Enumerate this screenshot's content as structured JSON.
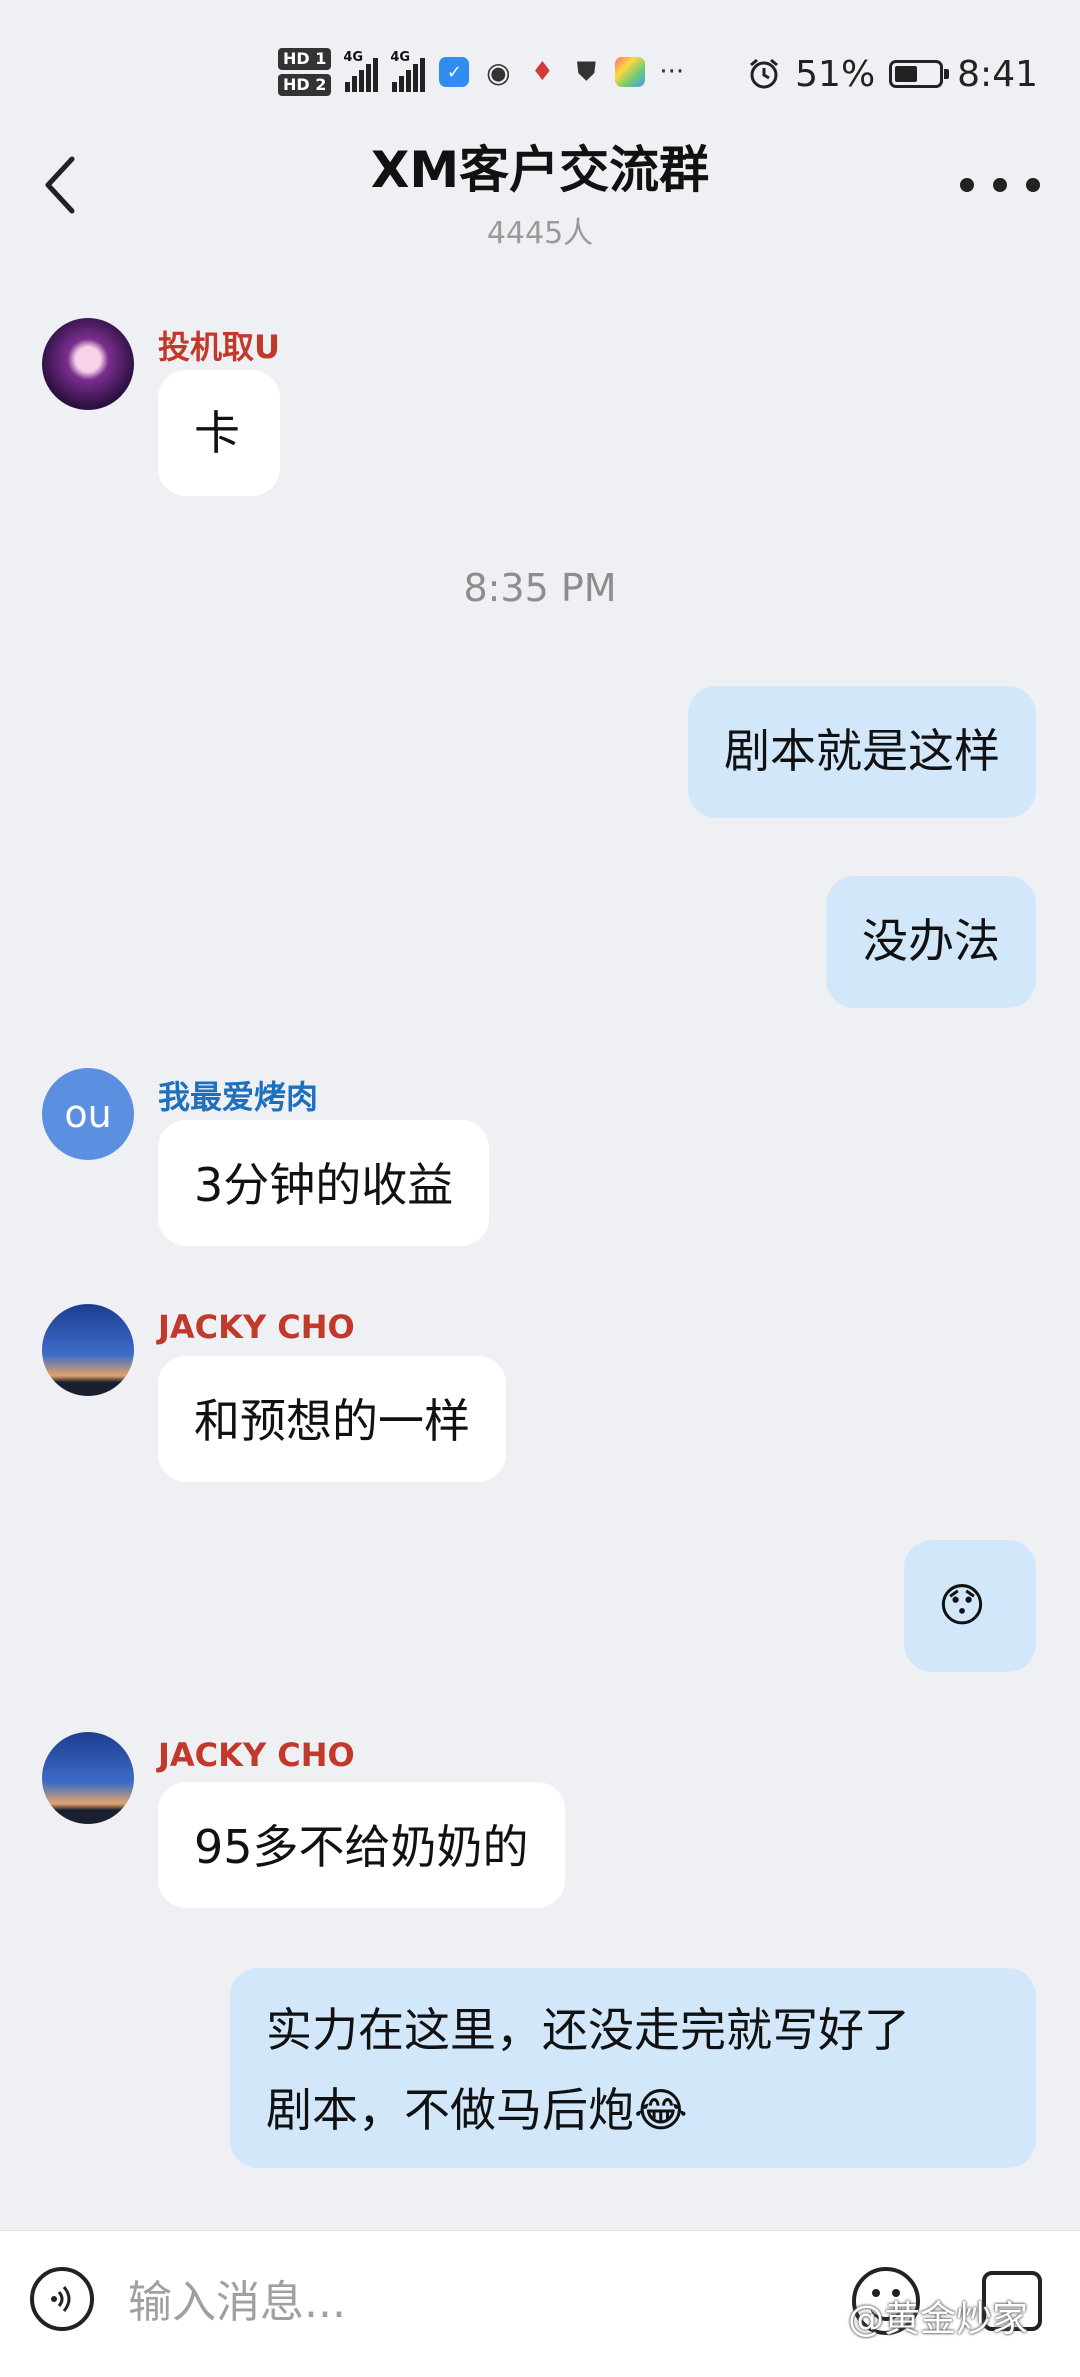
{
  "status_bar": {
    "hd1": "HD 1",
    "hd2": "HD 2",
    "net1": "4G",
    "net2": "4G",
    "battery_percent": "51%",
    "battery_level": 0.51,
    "time": "8:41",
    "overflow": "···"
  },
  "header": {
    "title": "XM客户交流群",
    "member_count": "4445人"
  },
  "messages": [
    {
      "direction": "in",
      "sender": "投机取U",
      "sender_color": "#c0392b",
      "text": "卡"
    },
    {
      "type": "time",
      "text": "8:35 PM"
    },
    {
      "direction": "out",
      "text": "剧本就是这样"
    },
    {
      "direction": "out",
      "text": "没办法"
    },
    {
      "direction": "in",
      "sender": "我最爱烤肉",
      "sender_color": "#1f6fbf",
      "avatar_text": "ou",
      "text": "3分钟的收益"
    },
    {
      "direction": "in",
      "sender": "JACKY CHO",
      "sender_color": "#c0392b",
      "text": "和预想的一样"
    },
    {
      "direction": "out",
      "text": "😯"
    },
    {
      "direction": "in",
      "sender": "JACKY CHO",
      "sender_color": "#c0392b",
      "text": "95多不给奶奶的"
    },
    {
      "direction": "out",
      "text_line1": "实力在这里，还没走完就写好了",
      "text_line2": "剧本，不做马后炮😂"
    }
  ],
  "input_bar": {
    "placeholder": "输入消息..."
  },
  "watermark": "@黄金炒家"
}
